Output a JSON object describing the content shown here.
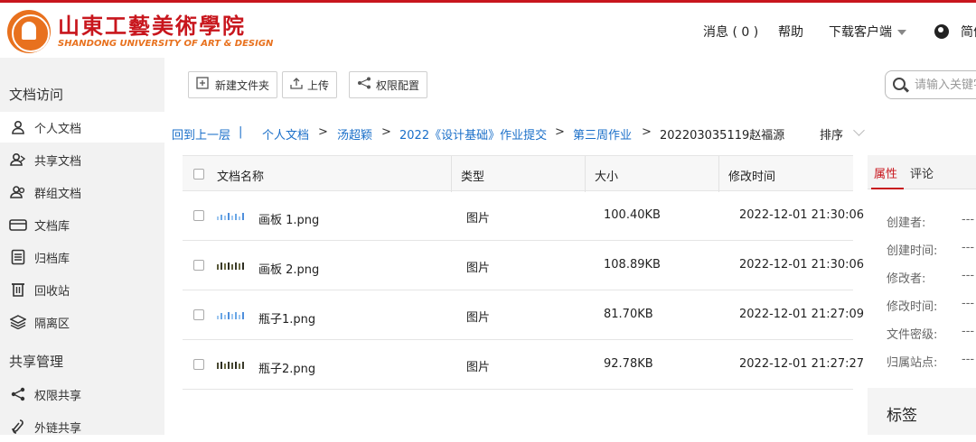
{
  "header": {
    "logo_cn": "山東工藝美術學院",
    "logo_en": "SHANDONG UNIVERSITY OF ART & DESIGN",
    "messages": "消息 ( 0 )",
    "help": "帮助",
    "download": "下载客户端",
    "language": "简体",
    "accent_color": "#c8161d",
    "brand_orange": "#e8711e"
  },
  "sidebar": {
    "section1": "文档访问",
    "items": [
      {
        "label": "个人文档",
        "icon": "person-icon"
      },
      {
        "label": "共享文档",
        "icon": "shared-person-icon"
      },
      {
        "label": "群组文档",
        "icon": "group-icon"
      },
      {
        "label": "文档库",
        "icon": "library-icon"
      },
      {
        "label": "归档库",
        "icon": "archive-icon"
      },
      {
        "label": "回收站",
        "icon": "trash-icon"
      },
      {
        "label": "隔离区",
        "icon": "layers-icon"
      }
    ],
    "section2": "共享管理",
    "items2": [
      {
        "label": "权限共享",
        "icon": "share-icon"
      },
      {
        "label": "外链共享",
        "icon": "link-icon"
      }
    ]
  },
  "toolbar": {
    "new_folder": "新建文件夹",
    "upload": "上传",
    "permissions": "权限配置",
    "search_placeholder": "请输入关键字"
  },
  "breadcrumb": {
    "back": "回到上一层",
    "divider": "|",
    "items": [
      "个人文档",
      "汤超颖",
      "2022《设计基础》作业提交",
      "第三周作业"
    ],
    "current": "202203035119赵福源",
    "sep": ">",
    "sort": "排序"
  },
  "table": {
    "headers": [
      "文档名称",
      "类型",
      "大小",
      "修改时间"
    ],
    "rows": [
      {
        "name": "画板 1.png",
        "type": "图片",
        "size": "100.40KB",
        "modified": "2022-12-01 21:30:06"
      },
      {
        "name": "画板 2.png",
        "type": "图片",
        "size": "108.89KB",
        "modified": "2022-12-01 21:30:06"
      },
      {
        "name": "瓶子1.png",
        "type": "图片",
        "size": "81.70KB",
        "modified": "2022-12-01 21:27:09"
      },
      {
        "name": "瓶子2.png",
        "type": "图片",
        "size": "92.78KB",
        "modified": "2022-12-01 21:27:27"
      }
    ]
  },
  "panel": {
    "tab_properties": "属性",
    "tab_comments": "评论",
    "props": [
      {
        "label": "创建者:",
        "value": "---"
      },
      {
        "label": "创建时间:",
        "value": "---"
      },
      {
        "label": "修改者:",
        "value": "---"
      },
      {
        "label": "修改时间:",
        "value": "---"
      },
      {
        "label": "文件密级:",
        "value": "---"
      },
      {
        "label": "归属站点:",
        "value": "---"
      }
    ],
    "tags": "标签"
  }
}
